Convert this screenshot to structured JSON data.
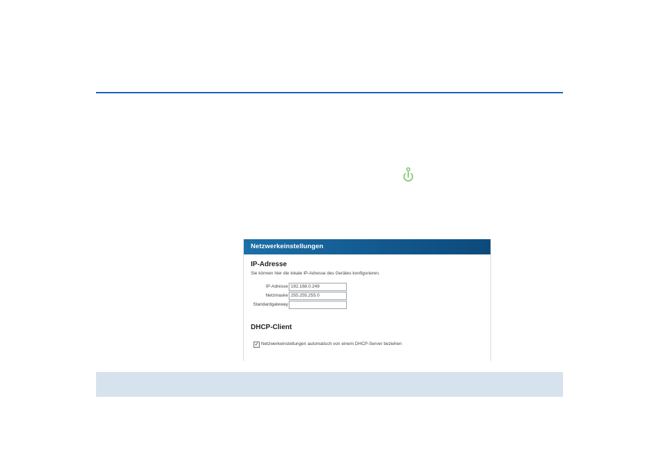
{
  "panel": {
    "title": "Netzwerkeinstellungen",
    "ip_section": {
      "heading": "IP-Adresse",
      "description": "Sie können hier die lokale IP-Adresse des Gerätes konfigurieren.",
      "fields": [
        {
          "label": "IP-Adresse",
          "value": "192.168.0.249"
        },
        {
          "label": "Netzmaske",
          "value": "255.255.255.0"
        },
        {
          "label": "Standardgateway",
          "value": ""
        }
      ]
    },
    "dhcp_section": {
      "heading": "DHCP-Client",
      "checkbox_checked": true,
      "checkbox_label": "Netzwerkeinstellungen automatisch von einem DHCP-Server beziehen"
    }
  },
  "icons": {
    "power": "power-icon"
  },
  "colors": {
    "rule": "#1f5fb4",
    "header": "#12598f",
    "power_icon": "#8fcf7a",
    "band": "#d6e3ee"
  }
}
